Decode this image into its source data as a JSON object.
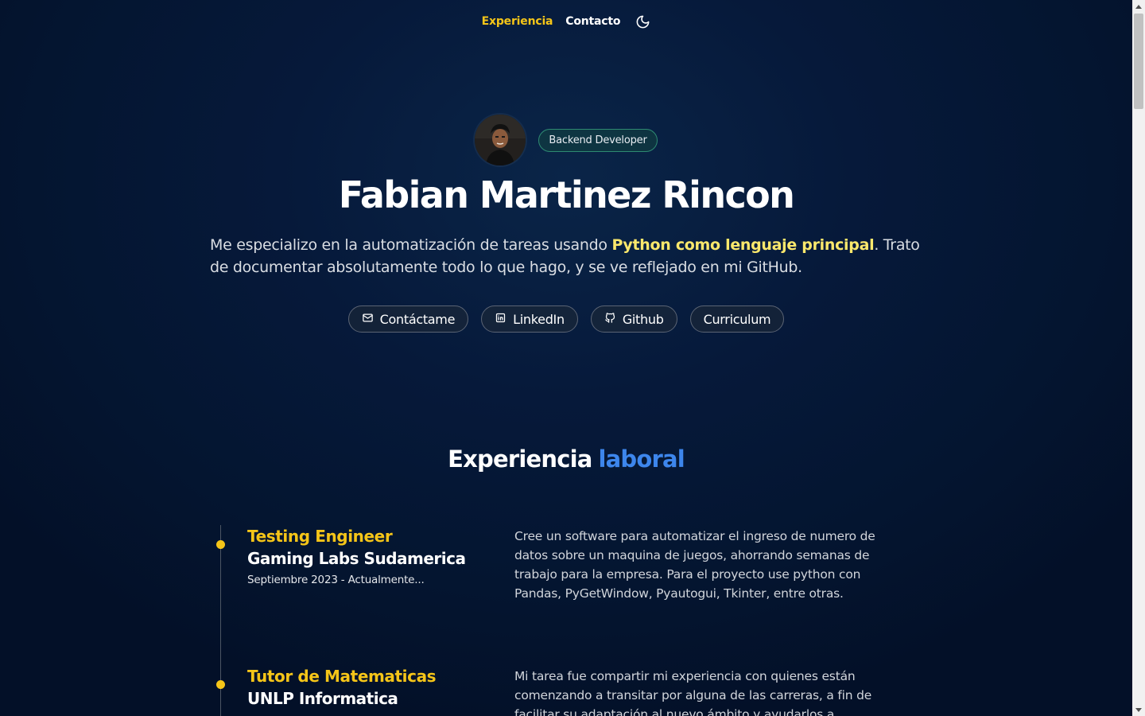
{
  "nav": {
    "links": [
      "Experiencia",
      "Contacto"
    ],
    "theme_toggle_icon": "moon-icon",
    "active_color": "#f5c518"
  },
  "hero": {
    "role_badge": "Backend Developer",
    "name": "Fabian Martinez Rincon",
    "intro_before": "Me especializo en la automatización de tareas usando ",
    "intro_highlight": "Python como lenguaje principal",
    "intro_after": ". Trato de documentar absolutamente todo lo que hago, y se ve reflejado en mi GitHub.",
    "buttons": [
      {
        "label": "Contáctame",
        "icon": "mail-icon"
      },
      {
        "label": "LinkedIn",
        "icon": "linkedin-icon"
      },
      {
        "label": "Github",
        "icon": "github-icon"
      },
      {
        "label": "Curriculum",
        "icon": ""
      }
    ]
  },
  "experience": {
    "title": "Experiencia",
    "title_accent": "laboral",
    "items": [
      {
        "role": "Testing Engineer",
        "company": "Gaming Labs Sudamerica",
        "date": "Septiembre 2023 - Actualmente...",
        "description": "Cree un software para automatizar el ingreso de numero de datos sobre un maquina de juegos, ahorrando semanas de trabajo para la empresa. Para el proyecto use python con Pandas, PyGetWindow, Pyautogui, Tkinter, entre otras."
      },
      {
        "role": "Tutor de Matematicas",
        "company": "UNLP Informatica",
        "date": "",
        "description": "Mi tarea fue compartir mi experiencia con quienes están comenzando a transitar por alguna de las carreras, a fin de facilitar su adaptación al nuevo ámbito y ayudarlos a construir"
      }
    ]
  },
  "colors": {
    "accent_yellow": "#f5c518",
    "accent_blue": "#3d86ec",
    "highlight": "#fbe86c",
    "background": "#041530"
  }
}
